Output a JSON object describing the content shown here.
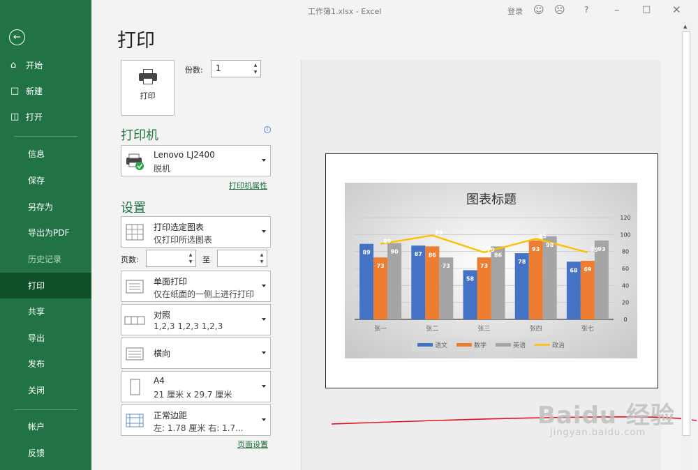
{
  "titlebar": {
    "title": "工作簿1.xlsx  -  Excel",
    "login": "登录",
    "help": "?"
  },
  "sidebar": {
    "top_items": [
      {
        "label": "开始",
        "icon": "home-icon"
      },
      {
        "label": "新建",
        "icon": "new-document-icon"
      },
      {
        "label": "打开",
        "icon": "folder-open-icon"
      }
    ],
    "mid_items": [
      "信息",
      "保存",
      "另存为",
      "导出为PDF",
      "历史记录",
      "打印",
      "共享",
      "导出",
      "发布",
      "关闭"
    ],
    "bottom_items": [
      "帐户",
      "反馈"
    ],
    "active": "打印"
  },
  "page_title": "打印",
  "print_button": "打印",
  "copies": {
    "label": "份数:",
    "value": "1"
  },
  "printer": {
    "heading": "打印机",
    "name": "Lenovo LJ2400",
    "status": "脱机",
    "properties_link": "打印机属性"
  },
  "settings": {
    "heading": "设置",
    "what": {
      "line1": "打印选定图表",
      "line2": "仅打印所选图表"
    },
    "pages_label": "页数:",
    "pages_to": "至",
    "sides": {
      "line1": "单面打印",
      "line2": "仅在纸面的一侧上进行打印"
    },
    "collate": {
      "line1": "对照",
      "line2": "1,2,3    1,2,3    1,2,3"
    },
    "orientation": {
      "line1": "横向"
    },
    "paper": {
      "line1": "A4",
      "line2": "21 厘米 x 29.7 厘米"
    },
    "margins": {
      "line1": "正常边距",
      "line2": "左: 1.78 厘米    右: 1.7..."
    },
    "page_setup_link": "页面设置"
  },
  "chart_data": {
    "type": "bar",
    "title": "图表标题",
    "categories": [
      "张一",
      "张二",
      "张三",
      "张四",
      "张七"
    ],
    "series": [
      {
        "name": "语文",
        "kind": "bar",
        "color": "#4472c4",
        "values": [
          89,
          87,
          58,
          78,
          68
        ]
      },
      {
        "name": "数学",
        "kind": "bar",
        "color": "#ed7d31",
        "values": [
          73,
          86,
          73,
          93,
          69
        ]
      },
      {
        "name": "英语",
        "kind": "bar",
        "color": "#a5a5a5",
        "values": [
          90,
          73,
          86,
          98,
          93
        ]
      },
      {
        "name": "政治",
        "kind": "line",
        "color": "#ffc000",
        "values": [
          89,
          99,
          79,
          95,
          79
        ]
      }
    ],
    "yticks": [
      0,
      20,
      40,
      60,
      80,
      100,
      120
    ],
    "ylim": [
      0,
      120
    ],
    "y_axis_side": "right",
    "grid": true,
    "legend": "bottom"
  },
  "watermark": {
    "line1": "Baidu 经验",
    "line2": "jingyan.baidu.com"
  },
  "colors": {
    "accent": "#217346",
    "active_nav": "#0f4f2a",
    "annotation": "#e0141e"
  }
}
